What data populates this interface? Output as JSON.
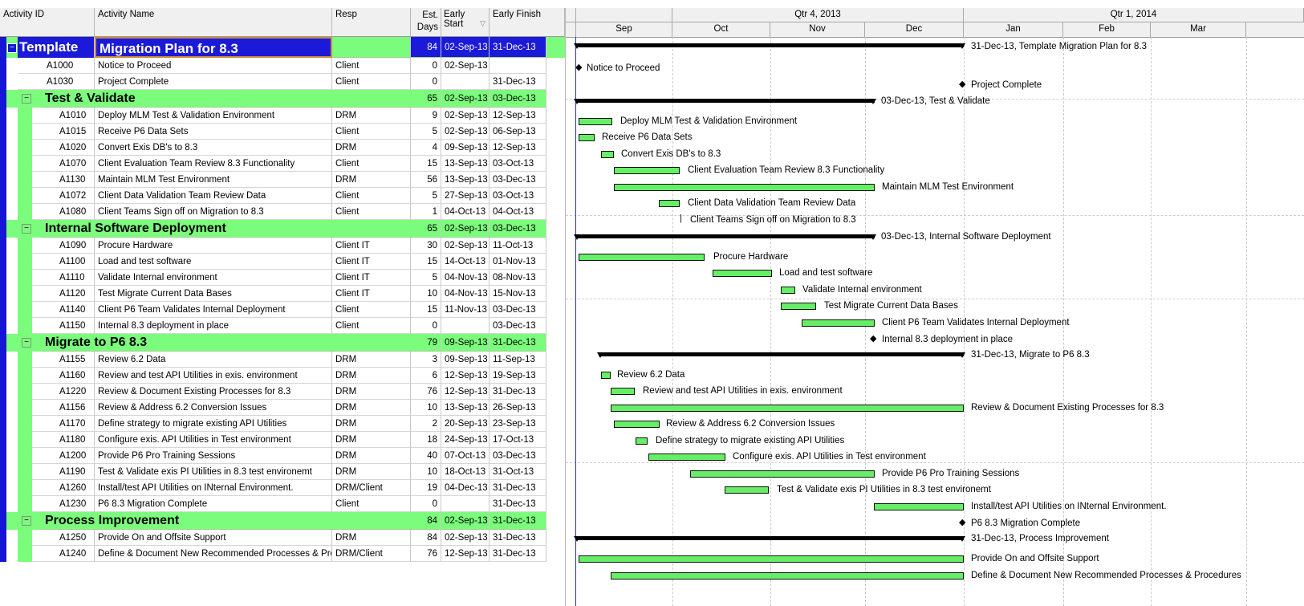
{
  "columns": {
    "activity_id": "Activity ID",
    "activity_name": "Activity Name",
    "resp": "Resp",
    "est_days_1": "Est.",
    "est_days_2": "Days",
    "early_start": "Early Start",
    "early_finish": "Early Finish"
  },
  "timescale": {
    "quarters": [
      "Qtr 4, 2013",
      "Qtr 1, 2014"
    ],
    "months": [
      "Sep",
      "Oct",
      "Nov",
      "Dec",
      "Jan",
      "Feb",
      "Mar"
    ]
  },
  "colors": {
    "group_bg": "#7cfc7c",
    "bar_fill": "#66ee66",
    "selected_border": "#d08a3a",
    "left_accent": "#1515d6"
  },
  "rows": [
    {
      "kind": "project",
      "id": "Template",
      "name": "Migration Plan for 8.3",
      "resp": "",
      "days": "84",
      "start": "02-Sep-13",
      "finish": "31-Dec-13"
    },
    {
      "kind": "task",
      "id": "A1000",
      "name": "Notice to Proceed",
      "resp": "Client",
      "days": "0",
      "start": "02-Sep-13",
      "finish": ""
    },
    {
      "kind": "task",
      "id": "A1030",
      "name": "Project Complete",
      "resp": "Client",
      "days": "0",
      "start": "",
      "finish": "31-Dec-13"
    },
    {
      "kind": "group",
      "id": "Test & Validate",
      "name": "",
      "resp": "",
      "days": "65",
      "start": "02-Sep-13",
      "finish": "03-Dec-13"
    },
    {
      "kind": "task",
      "id": "A1010",
      "name": "Deploy MLM Test & Validation Environment",
      "resp": "DRM",
      "days": "9",
      "start": "02-Sep-13",
      "finish": "12-Sep-13"
    },
    {
      "kind": "task",
      "id": "A1015",
      "name": "Receive P6 Data Sets",
      "resp": "Client",
      "days": "5",
      "start": "02-Sep-13",
      "finish": "06-Sep-13"
    },
    {
      "kind": "task",
      "id": "A1020",
      "name": "Convert Exis DB's to 8.3",
      "resp": "DRM",
      "days": "4",
      "start": "09-Sep-13",
      "finish": "12-Sep-13"
    },
    {
      "kind": "task",
      "id": "A1070",
      "name": "Client Evaluation Team Review 8.3 Functionality",
      "resp": "Client",
      "days": "15",
      "start": "13-Sep-13",
      "finish": "03-Oct-13"
    },
    {
      "kind": "task",
      "id": "A1130",
      "name": "Maintain MLM Test Environment",
      "resp": "DRM",
      "days": "56",
      "start": "13-Sep-13",
      "finish": "03-Dec-13"
    },
    {
      "kind": "task",
      "id": "A1072",
      "name": "Client Data Validation Team Review Data",
      "resp": "Client",
      "days": "5",
      "start": "27-Sep-13",
      "finish": "03-Oct-13"
    },
    {
      "kind": "task",
      "id": "A1080",
      "name": "Client Teams Sign off on Migration to 8.3",
      "resp": "Client",
      "days": "1",
      "start": "04-Oct-13",
      "finish": "04-Oct-13"
    },
    {
      "kind": "group",
      "id": "Internal Software Deployment",
      "name": "",
      "resp": "",
      "days": "65",
      "start": "02-Sep-13",
      "finish": "03-Dec-13"
    },
    {
      "kind": "task",
      "id": "A1090",
      "name": "Procure Hardware",
      "resp": "Client IT",
      "days": "30",
      "start": "02-Sep-13",
      "finish": "11-Oct-13"
    },
    {
      "kind": "task",
      "id": "A1100",
      "name": "Load and test software",
      "resp": "Client IT",
      "days": "15",
      "start": "14-Oct-13",
      "finish": "01-Nov-13"
    },
    {
      "kind": "task",
      "id": "A1110",
      "name": "Validate Internal environment",
      "resp": "Client IT",
      "days": "5",
      "start": "04-Nov-13",
      "finish": "08-Nov-13"
    },
    {
      "kind": "task",
      "id": "A1120",
      "name": "Test Migrate Current Data Bases",
      "resp": "Client IT",
      "days": "10",
      "start": "04-Nov-13",
      "finish": "15-Nov-13"
    },
    {
      "kind": "task",
      "id": "A1140",
      "name": "Client P6 Team Validates Internal Deployment",
      "resp": "Client",
      "days": "15",
      "start": "11-Nov-13",
      "finish": "03-Dec-13"
    },
    {
      "kind": "task",
      "id": "A1150",
      "name": "Internal 8.3 deployment in place",
      "resp": "Client",
      "days": "0",
      "start": "",
      "finish": "03-Dec-13"
    },
    {
      "kind": "group",
      "id": "Migrate to P6 8.3",
      "name": "",
      "resp": "",
      "days": "79",
      "start": "09-Sep-13",
      "finish": "31-Dec-13"
    },
    {
      "kind": "task",
      "id": "A1155",
      "name": "Review 6.2 Data",
      "resp": "DRM",
      "days": "3",
      "start": "09-Sep-13",
      "finish": "11-Sep-13"
    },
    {
      "kind": "task",
      "id": "A1160",
      "name": "Review and test API Utilities in exis. environment",
      "resp": "DRM",
      "days": "6",
      "start": "12-Sep-13",
      "finish": "19-Sep-13"
    },
    {
      "kind": "task",
      "id": "A1220",
      "name": "Review & Document Existing Processes for 8.3",
      "resp": "DRM",
      "days": "76",
      "start": "12-Sep-13",
      "finish": "31-Dec-13"
    },
    {
      "kind": "task",
      "id": "A1156",
      "name": "Review & Address 6.2 Conversion Issues",
      "resp": "DRM",
      "days": "10",
      "start": "13-Sep-13",
      "finish": "26-Sep-13"
    },
    {
      "kind": "task",
      "id": "A1170",
      "name": "Define strategy to migrate existing API Utilities",
      "resp": "DRM",
      "days": "2",
      "start": "20-Sep-13",
      "finish": "23-Sep-13"
    },
    {
      "kind": "task",
      "id": "A1180",
      "name": "Configure exis. API Utilities in Test environment",
      "resp": "DRM",
      "days": "18",
      "start": "24-Sep-13",
      "finish": "17-Oct-13"
    },
    {
      "kind": "task",
      "id": "A1200",
      "name": "Provide P6 Pro Training Sessions",
      "resp": "DRM",
      "days": "40",
      "start": "07-Oct-13",
      "finish": "03-Dec-13"
    },
    {
      "kind": "task",
      "id": "A1190",
      "name": "Test & Validate exis PI Utilities in 8.3 test environemt",
      "resp": "DRM",
      "days": "10",
      "start": "18-Oct-13",
      "finish": "31-Oct-13"
    },
    {
      "kind": "task",
      "id": "A1260",
      "name": "Install/test API Utilities on INternal Environment.",
      "resp": "DRM/Client",
      "days": "19",
      "start": "04-Dec-13",
      "finish": "31-Dec-13"
    },
    {
      "kind": "task",
      "id": "A1230",
      "name": "P6 8.3 Migration Complete",
      "resp": "Client",
      "days": "0",
      "start": "",
      "finish": "31-Dec-13"
    },
    {
      "kind": "group",
      "id": "Process Improvement",
      "name": "",
      "resp": "",
      "days": "84",
      "start": "02-Sep-13",
      "finish": "31-Dec-13"
    },
    {
      "kind": "task",
      "id": "A1250",
      "name": "Provide On and Offsite Support",
      "resp": "DRM",
      "days": "84",
      "start": "02-Sep-13",
      "finish": "31-Dec-13"
    },
    {
      "kind": "task",
      "id": "A1240",
      "name": "Define & Document New Recommended Processes & Procedures",
      "resp": "DRM/Client",
      "days": "76",
      "start": "12-Sep-13",
      "finish": "31-Dec-13"
    }
  ],
  "gantt_labels": {
    "project": "31-Dec-13, Template Migration Plan for 8.3",
    "test_validate": "03-Dec-13, Test & Validate",
    "internal": "03-Dec-13, Internal Software Deployment",
    "migrate": "31-Dec-13, Migrate to P6 8.3",
    "process": "31-Dec-13, Process Improvement"
  }
}
